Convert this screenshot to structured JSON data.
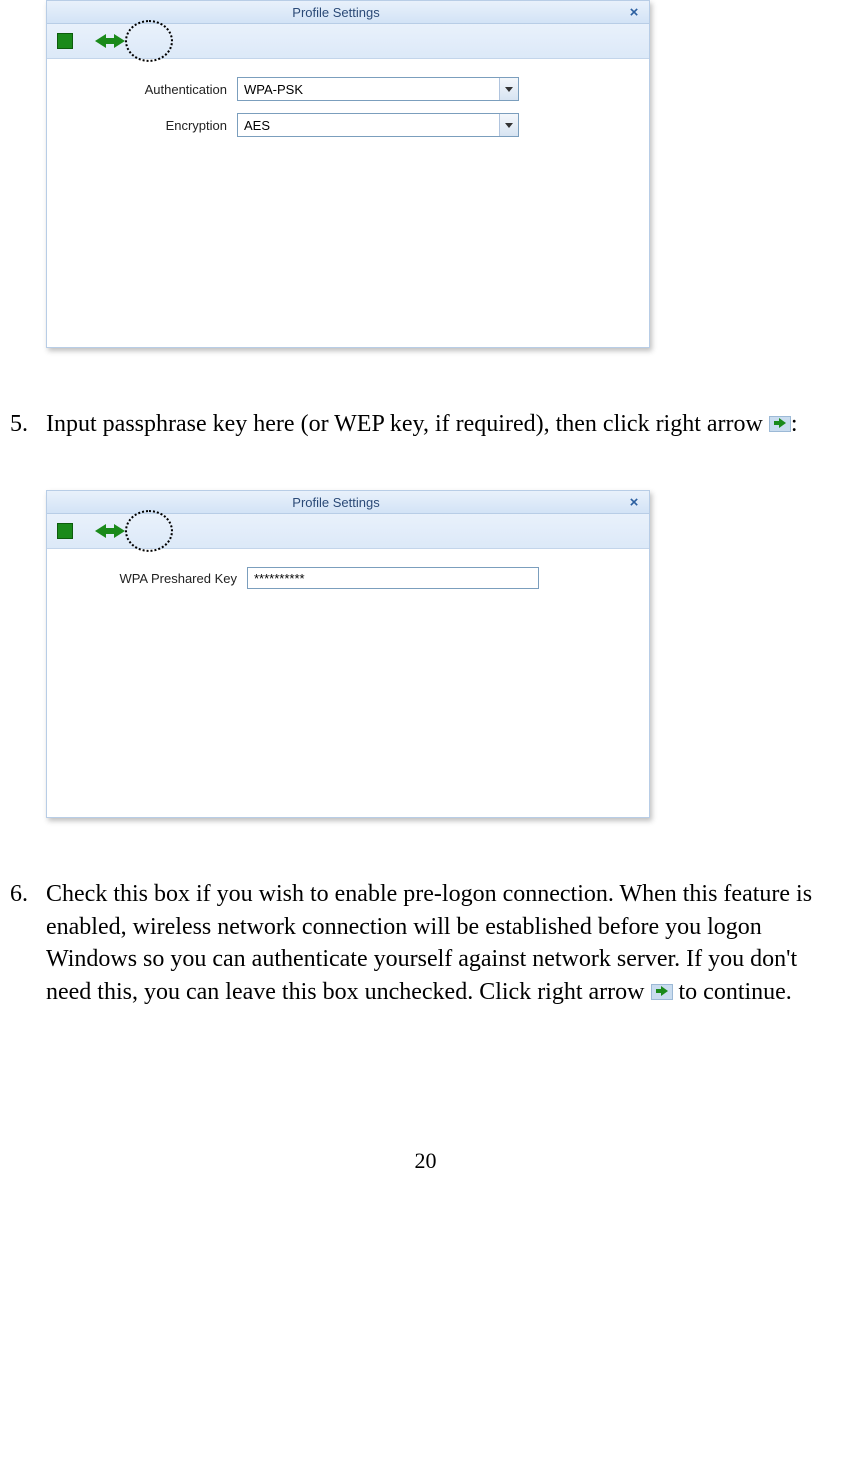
{
  "dialog1": {
    "title": "Profile Settings",
    "close": "×",
    "fields": {
      "auth_label": "Authentication",
      "auth_value": "WPA-PSK",
      "enc_label": "Encryption",
      "enc_value": "AES"
    }
  },
  "step5": {
    "num": "5.",
    "text_before": "Input passphrase key here (or WEP key, if required), then click right arrow ",
    "text_after": ":"
  },
  "dialog2": {
    "title": "Profile Settings",
    "close": "×",
    "fields": {
      "psk_label": "WPA Preshared Key",
      "psk_value": "**********"
    }
  },
  "step6": {
    "num": "6.",
    "text_before": "Check this box if you wish to enable pre-logon connection. When this feature is enabled, wireless network connection will be established before you logon Windows so you can authenticate yourself against network server. If you don't need this, you can leave this box unchecked. Click right arrow ",
    "text_after": " to continue."
  },
  "page_number": "20"
}
